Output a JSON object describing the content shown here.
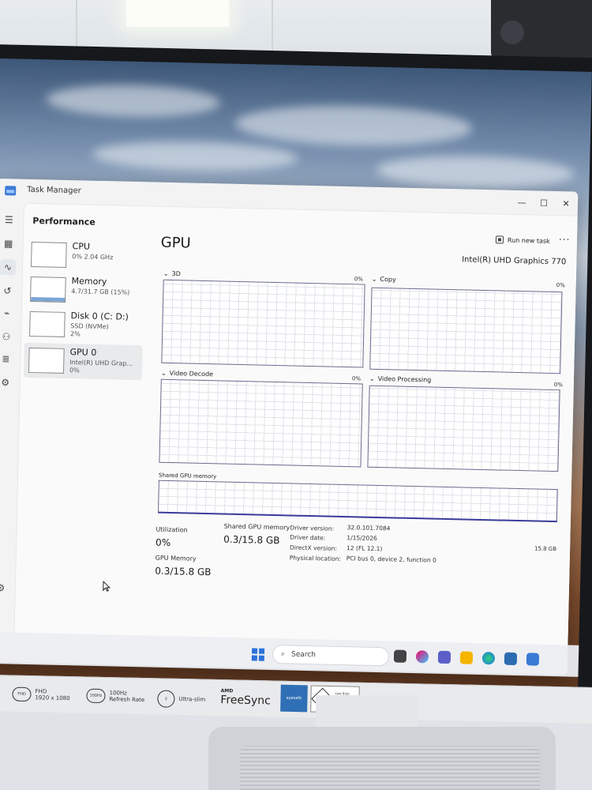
{
  "window": {
    "title": "Task Manager",
    "minimize": "—",
    "maximize": "☐",
    "close": "✕"
  },
  "header": {
    "section": "Performance",
    "run_new_task": "Run new task",
    "more": "···"
  },
  "sidebar_icons": [
    "hamburger-icon",
    "processes-icon",
    "performance-icon",
    "app-history-icon",
    "startup-icon",
    "users-icon",
    "details-icon",
    "services-icon",
    "settings-icon"
  ],
  "devices": [
    {
      "name": "CPU",
      "line1": "0% 2.04 GHz",
      "line2": ""
    },
    {
      "name": "Memory",
      "line1": "4.7/31.7 GB (15%)",
      "line2": ""
    },
    {
      "name": "Disk 0 (C: D:)",
      "line1": "SSD (NVMe)",
      "line2": "2%"
    },
    {
      "name": "GPU 0",
      "line1": "Intel(R) UHD Grap...",
      "line2": "0%"
    }
  ],
  "gpu": {
    "title": "GPU",
    "model": "Intel(R) UHD Graphics 770",
    "engines": [
      {
        "name": "3D",
        "pct": "0%"
      },
      {
        "name": "Copy",
        "pct": "0%"
      },
      {
        "name": "Video Decode",
        "pct": "0%"
      },
      {
        "name": "Video Processing",
        "pct": "0%"
      }
    ],
    "shared_label": "Shared GPU memory",
    "shared_max": "15.8 GB",
    "stats": {
      "utilization_label": "Utilization",
      "utilization_value": "0%",
      "shared_label": "Shared GPU memory",
      "shared_value": "0.3/15.8 GB",
      "gpu_memory_label": "GPU Memory",
      "gpu_memory_value": "0.3/15.8 GB"
    },
    "details": [
      {
        "key": "Driver version:",
        "value": "32.0.101.7084"
      },
      {
        "key": "Driver date:",
        "value": "1/15/2026"
      },
      {
        "key": "DirectX version:",
        "value": "12 (FL 12.1)"
      },
      {
        "key": "Physical location:",
        "value": "PCI bus 0, device 2, function 0"
      }
    ]
  },
  "taskbar": {
    "search_placeholder": "Search"
  },
  "monitor": {
    "fhd_badge": "FHD",
    "fhd_text_1": "FHD",
    "fhd_text_2": "1920 x 1080",
    "hz_badge": "100Hz",
    "hz_text_1": "100Hz",
    "hz_text_2": "Refresh Rate",
    "slim_text": "Ultra-slim",
    "amd_small": "AMD",
    "freesync": "FreeSync",
    "eyesafe": "eyesafe",
    "tuv": "Low Blue Light Hardware Solution"
  },
  "colors": {
    "accent": "#3a6fd0",
    "graph_border": "#6b6b8e",
    "memory_fill": "#7aa6d6"
  }
}
